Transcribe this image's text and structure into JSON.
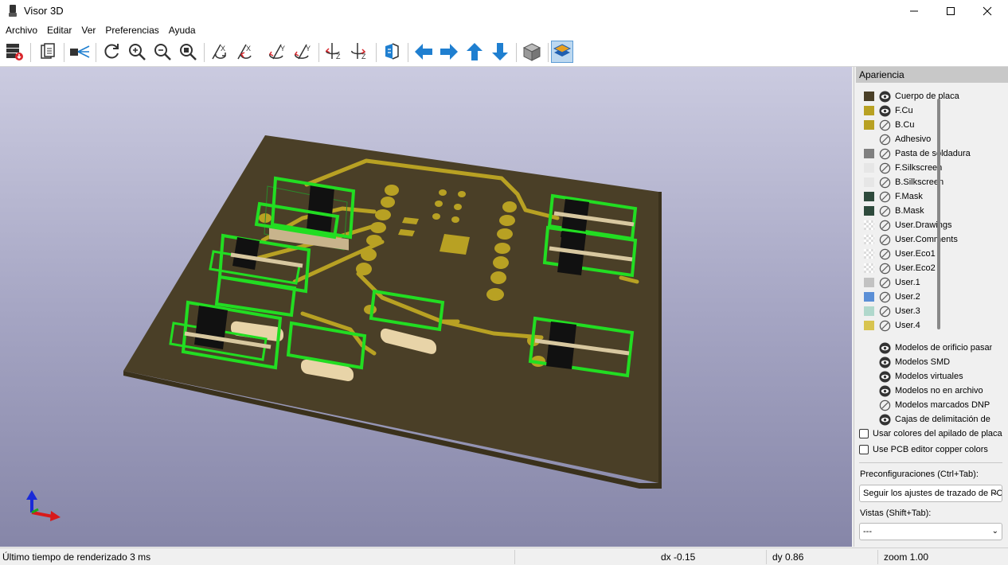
{
  "window": {
    "title": "Visor 3D",
    "minimize_icon": "minimize-icon",
    "maximize_icon": "maximize-icon",
    "close_icon": "close-icon"
  },
  "menu": [
    "Archivo",
    "Editar",
    "Ver",
    "Preferencias",
    "Ayuda"
  ],
  "toolbar": {
    "icons": [
      "export-image-icon",
      "copy-clipboard-icon",
      "raytrace-icon",
      "refresh-icon",
      "zoom-in-icon",
      "zoom-out-icon",
      "zoom-fit-icon",
      "rotate-x-cw-icon",
      "rotate-x-ccw-icon",
      "rotate-y-cw-icon",
      "rotate-y-ccw-icon",
      "rotate-z-cw-icon",
      "rotate-z-ccw-icon",
      "flip-board-icon",
      "move-left-icon",
      "move-right-icon",
      "move-up-icon",
      "move-down-icon",
      "orthographic-icon",
      "layers-panel-icon"
    ],
    "active_icon": "layers-panel-icon"
  },
  "panel": {
    "title": "Apariencia",
    "layers": [
      {
        "label": "Cuerpo de placa",
        "color": "#4a3f27",
        "visible": true
      },
      {
        "label": "F.Cu",
        "color": "#b8a123",
        "visible": true
      },
      {
        "label": "B.Cu",
        "color": "#b8a123",
        "visible": false
      },
      {
        "label": "Adhesivo",
        "color": "",
        "visible": false
      },
      {
        "label": "Pasta de soldadura",
        "color": "#808080",
        "visible": false
      },
      {
        "label": "F.Silkscreen",
        "color": "#e6e6e6",
        "visible": false
      },
      {
        "label": "B.Silkscreen",
        "color": "#e6e6e6",
        "visible": false
      },
      {
        "label": "F.Mask",
        "color": "#2e4a3c",
        "visible": false
      },
      {
        "label": "B.Mask",
        "color": "#2e4a3c",
        "visible": false
      },
      {
        "label": "User.Drawings",
        "color": "checker",
        "visible": false
      },
      {
        "label": "User.Comments",
        "color": "checker",
        "visible": false
      },
      {
        "label": "User.Eco1",
        "color": "checker",
        "visible": false
      },
      {
        "label": "User.Eco2",
        "color": "checker",
        "visible": false
      },
      {
        "label": "User.1",
        "color": "#c2c2c2",
        "visible": false
      },
      {
        "label": "User.2",
        "color": "#5b8fd6",
        "visible": false
      },
      {
        "label": "User.3",
        "color": "#b0d8cc",
        "visible": false
      },
      {
        "label": "User.4",
        "color": "#d8c44f",
        "visible": false
      }
    ],
    "models": [
      {
        "label": "Modelos de orificio pasante",
        "visible": true
      },
      {
        "label": "Modelos SMD",
        "visible": true
      },
      {
        "label": "Modelos virtuales",
        "visible": true
      },
      {
        "label": "Modelos no en archivo",
        "visible": true
      },
      {
        "label": "Modelos marcados DNP",
        "visible": false
      },
      {
        "label": "Cajas de delimitación de modelos",
        "visible": true
      }
    ],
    "checkbox_stackup": "Usar colores del apilado de placa",
    "checkbox_copper": "Use PCB editor copper colors",
    "presets_label": "Preconfiguraciones (Ctrl+Tab):",
    "presets_value": "Seguir los ajustes de trazado de PCB",
    "views_label": "Vistas (Shift+Tab):",
    "views_value": "---"
  },
  "status": {
    "render_time": "Último tiempo de renderizado 3 ms",
    "dx": "dx -0.15",
    "dy": "dy 0.86",
    "zoom": "zoom 1.00"
  },
  "colors": {
    "board": "#4a3f27",
    "copper": "#b8a123",
    "bbox": "#22dd22",
    "accent": "#1f7fd0"
  }
}
